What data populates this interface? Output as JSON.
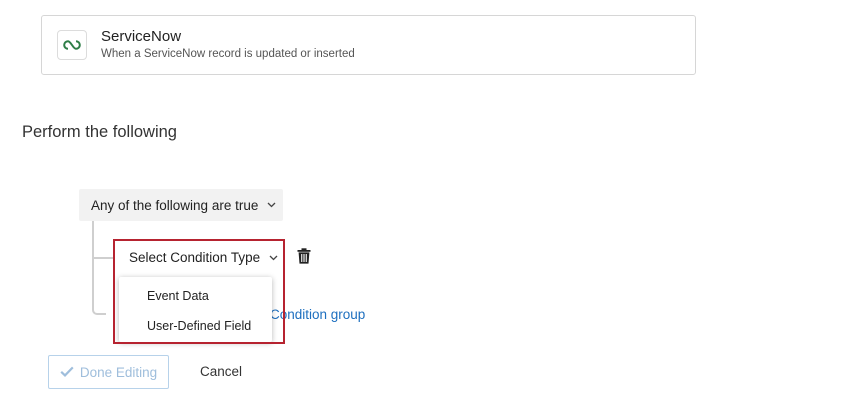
{
  "trigger": {
    "title": "ServiceNow",
    "subtitle": "When a ServiceNow record is updated or inserted",
    "icon": "servicenow-logo-icon"
  },
  "section_heading": "Perform the following",
  "condition_group": {
    "match_label": "Any of the following are true",
    "condition_type_label": "Select Condition Type",
    "menu_items": [
      "Event Data",
      "User-Defined Field"
    ],
    "add_group_link": "Condition group"
  },
  "footer": {
    "done_label": "Done Editing",
    "cancel_label": "Cancel"
  },
  "colors": {
    "highlight": "#b62330",
    "link": "#1d6fbf",
    "logo_green": "#2d7d46",
    "disabled_text": "#9fbedc"
  }
}
